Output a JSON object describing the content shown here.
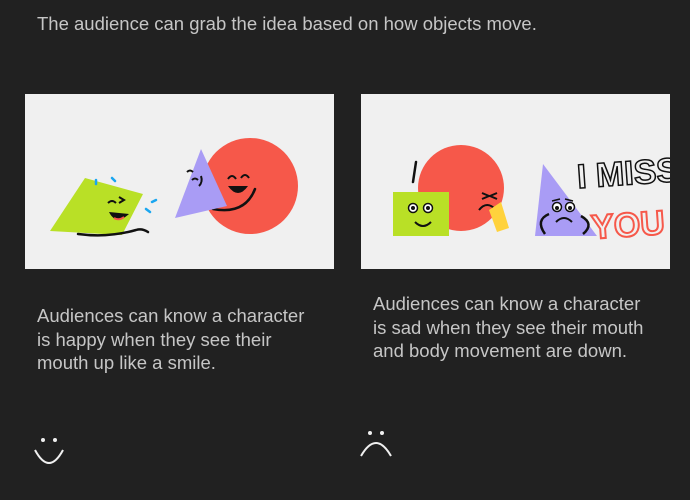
{
  "intro_text": "The audience can grab the idea based on how objects move.",
  "panels": [
    {
      "icon": "happy-characters-illustration",
      "caption": "Audiences can know a character is happy when they see their mouth up like a smile.",
      "face_icon": "smile-icon"
    },
    {
      "icon": "sad-characters-illustration",
      "caption": "Audiences can know a character is sad when they see their mouth and body movement are down.",
      "face_icon": "frown-icon",
      "lettering": [
        "I MISS",
        "YOU"
      ]
    }
  ],
  "colors": {
    "background": "#212121",
    "panel": "#f0f0f0",
    "circle": "#f6584a",
    "square": "#b9e026",
    "triangle": "#a99cf5",
    "accent_yellow": "#ffd23c",
    "accent_blue": "#1aa6f0"
  }
}
